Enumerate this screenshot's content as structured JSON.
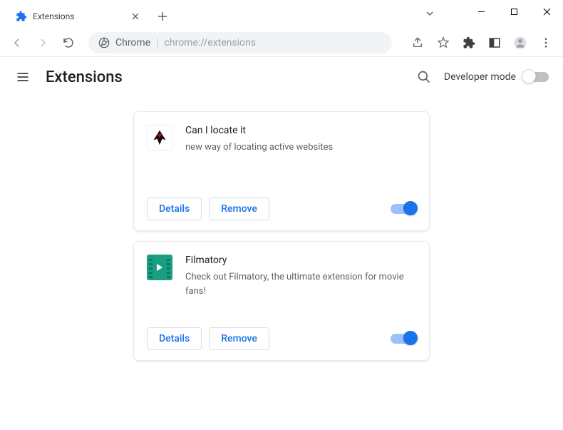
{
  "window": {
    "tab_title": "Extensions",
    "address_scheme": "Chrome",
    "address_path": "chrome://extensions"
  },
  "header": {
    "title": "Extensions",
    "devmode_label": "Developer mode"
  },
  "extensions": [
    {
      "name": "Can I locate it",
      "description": "new way of locating active websites",
      "details_label": "Details",
      "remove_label": "Remove",
      "enabled": true,
      "icon": "eagle-icon"
    },
    {
      "name": "Filmatory",
      "description": "Check out Filmatory, the ultimate extension for movie fans!",
      "details_label": "Details",
      "remove_label": "Remove",
      "enabled": true,
      "icon": "film-icon"
    }
  ]
}
